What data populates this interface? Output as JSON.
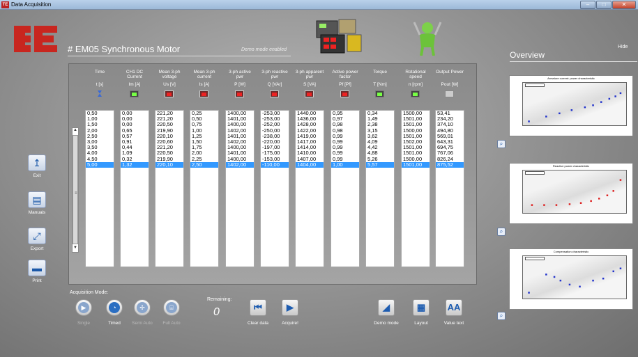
{
  "window": {
    "title": "Data Acquisition",
    "blurred_subtitle": ""
  },
  "header": {
    "title": "# EM05 Synchronous Motor",
    "demo_notice": "Demo mode enabled"
  },
  "overview": {
    "title": "Overview",
    "hide_label": "Hide",
    "charts": [
      {
        "title": "Armature current: power characteristic",
        "series_color": "#2233cc",
        "points": [
          [
            0.05,
            0.1
          ],
          [
            0.22,
            0.22
          ],
          [
            0.35,
            0.3
          ],
          [
            0.47,
            0.38
          ],
          [
            0.6,
            0.45
          ],
          [
            0.68,
            0.5
          ],
          [
            0.76,
            0.58
          ],
          [
            0.84,
            0.66
          ],
          [
            0.9,
            0.72
          ],
          [
            0.95,
            0.8
          ]
        ]
      },
      {
        "title": "Reactive power characteristic",
        "series_color": "#dd2222",
        "points": [
          [
            0.08,
            0.2
          ],
          [
            0.2,
            0.2
          ],
          [
            0.32,
            0.2
          ],
          [
            0.45,
            0.22
          ],
          [
            0.56,
            0.25
          ],
          [
            0.66,
            0.3
          ],
          [
            0.74,
            0.36
          ],
          [
            0.82,
            0.44
          ],
          [
            0.88,
            0.55
          ],
          [
            0.95,
            0.82
          ]
        ]
      },
      {
        "title": "Compensation characteristic",
        "series_color": "#2233cc",
        "points": [
          [
            0.05,
            0.15
          ],
          [
            0.22,
            0.6
          ],
          [
            0.3,
            0.54
          ],
          [
            0.36,
            0.45
          ],
          [
            0.45,
            0.35
          ],
          [
            0.55,
            0.3
          ],
          [
            0.68,
            0.45
          ],
          [
            0.78,
            0.5
          ],
          [
            0.88,
            0.68
          ],
          [
            0.95,
            0.75
          ]
        ]
      }
    ]
  },
  "columns": [
    {
      "name": "Time",
      "unit": "t [s]",
      "icon": "hourglass",
      "values": [
        "0,50",
        "1,00",
        "1,50",
        "2,00",
        "2,50",
        "3,00",
        "3,50",
        "4,00",
        "4,50",
        "5,00"
      ]
    },
    {
      "name": "CH1 DC Current",
      "unit": "Im [A]",
      "icon": "meter",
      "values": [
        "0,00",
        "0,00",
        "0,00",
        "0,65",
        "0,57",
        "0,91",
        "0,44",
        "1,09",
        "0,32",
        "1,32"
      ]
    },
    {
      "name": "Mean 3-ph voltage",
      "unit": "Us [V]",
      "icon": "red-meter",
      "values": [
        "221,20",
        "221,20",
        "220,50",
        "219,90",
        "220,10",
        "220,60",
        "221,20",
        "220,50",
        "219,90",
        "220,10"
      ]
    },
    {
      "name": "Mean 3-ph current",
      "unit": "Is [A]",
      "icon": "red-meter",
      "values": [
        "0,25",
        "0,50",
        "0,75",
        "1,00",
        "1,25",
        "1,50",
        "1,75",
        "2,00",
        "2,25",
        "2,50"
      ]
    },
    {
      "name": "3-ph active pwr",
      "unit": "P [W]",
      "icon": "red-meter",
      "values": [
        "1400,00",
        "1401,00",
        "1400,00",
        "1402,00",
        "1401,00",
        "1402,00",
        "1400,00",
        "1401,00",
        "1400,00",
        "1402,00"
      ]
    },
    {
      "name": "3-ph reactive pwr",
      "unit": "Q [VAr]",
      "icon": "red-meter",
      "values": [
        "-253,00",
        "-253,00",
        "-252,00",
        "-250,00",
        "-238,00",
        "-220,00",
        "-197,00",
        "-175,00",
        "-153,00",
        "-110,00"
      ]
    },
    {
      "name": "3-ph apparent pwr",
      "unit": "S [VA]",
      "icon": "red-meter",
      "values": [
        "1440,00",
        "1436,00",
        "1428,00",
        "1422,00",
        "1419,00",
        "1417,00",
        "1414,00",
        "1410,00",
        "1407,00",
        "1404,00"
      ]
    },
    {
      "name": "Active power factor",
      "unit": "Pf [Pf]",
      "icon": "red-meter",
      "values": [
        "0,95",
        "0,97",
        "0,98",
        "0,98",
        "0,99",
        "0,99",
        "0,99",
        "0,99",
        "0,99",
        "1,00"
      ]
    },
    {
      "name": "Torque",
      "unit": "T [Nm]",
      "icon": "meter",
      "values": [
        "0,34",
        "1,49",
        "2,38",
        "3,15",
        "3,62",
        "4,09",
        "4,42",
        "4,88",
        "5,26",
        "5,57"
      ]
    },
    {
      "name": "Rotational speed",
      "unit": "n [rpm]",
      "icon": "meter",
      "values": [
        "1500,00",
        "1501,00",
        "1501,00",
        "1500,00",
        "1501,00",
        "1502,00",
        "1501,00",
        "1501,00",
        "1500,00",
        "1501,00"
      ]
    },
    {
      "name": "Output Power",
      "unit": "Pout [W]",
      "icon": "motor",
      "values": [
        "53,41",
        "234,20",
        "374,10",
        "494,80",
        "569,01",
        "643,31",
        "694,75",
        "767,06",
        "826,24",
        "875,52"
      ]
    }
  ],
  "selected_row": 9,
  "left_buttons": [
    {
      "label": "Exit",
      "icon": "↥"
    },
    {
      "label": "Manuals",
      "icon": "▤"
    },
    {
      "label": "Export",
      "icon": "⤢"
    },
    {
      "label": "Print",
      "icon": "▬"
    }
  ],
  "acquisition": {
    "label": "Acquisition Mode:",
    "modes": [
      {
        "label": "Single",
        "active": false,
        "glyph": "▶"
      },
      {
        "label": "Timed",
        "active": true,
        "glyph": "◔"
      },
      {
        "label": "Semi Auto",
        "active": false,
        "glyph": "✢"
      },
      {
        "label": "Full Auto",
        "active": false,
        "glyph": "⌸"
      }
    ],
    "remaining_label": "Remaining:",
    "remaining_value": "0"
  },
  "actions": [
    {
      "label": "Clear data",
      "glyph": "⏮"
    },
    {
      "label": "Acquire!",
      "glyph": "▶"
    }
  ],
  "right_actions": [
    {
      "label": "Demo mode",
      "glyph": "◢"
    },
    {
      "label": "Layout",
      "glyph": "▦"
    },
    {
      "label": "Value text",
      "glyph": "AA"
    }
  ]
}
